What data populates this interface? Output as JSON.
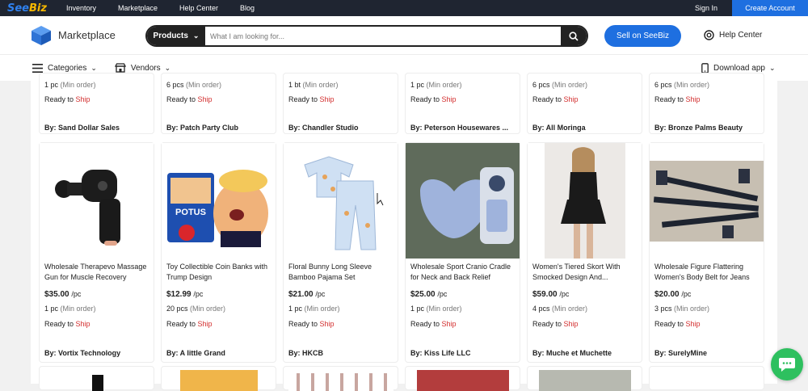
{
  "topbar": {
    "logo_see": "See",
    "logo_biz": "Biz",
    "nav": [
      "Inventory",
      "Marketplace",
      "Help Center",
      "Blog"
    ],
    "signin": "Sign In",
    "create_account": "Create Account"
  },
  "header": {
    "title": "Marketplace",
    "search_category": "Products",
    "search_placeholder": "What I am looking for...",
    "sell_button": "Sell on SeeBiz",
    "help_center": "Help Center"
  },
  "subnav": {
    "categories": "Categories",
    "vendors": "Vendors",
    "download_app": "Download app"
  },
  "top_row": [
    {
      "qty": "1 pc",
      "min": "(Min order)",
      "ready": "Ready to",
      "ship": "Ship",
      "vendor": "By: Sand Dollar Sales"
    },
    {
      "qty": "6 pcs",
      "min": "(Min order)",
      "ready": "Ready to",
      "ship": "Ship",
      "vendor": "By: Patch Party Club"
    },
    {
      "qty": "1 bt",
      "min": "(Min order)",
      "ready": "Ready to",
      "ship": "Ship",
      "vendor": "By: Chandler Studio"
    },
    {
      "qty": "1 pc",
      "min": "(Min order)",
      "ready": "Ready to",
      "ship": "Ship",
      "vendor": "By: Peterson Housewares ..."
    },
    {
      "qty": "6 pcs",
      "min": "(Min order)",
      "ready": "Ready to",
      "ship": "Ship",
      "vendor": "By: All Moringa"
    },
    {
      "qty": "6 pcs",
      "min": "(Min order)",
      "ready": "Ready to",
      "ship": "Ship",
      "vendor": "By: Bronze Palms Beauty"
    }
  ],
  "products": [
    {
      "title": "Wholesale Therapevo Massage Gun for Muscle Recovery",
      "price": "$35.00",
      "per": "/pc",
      "qty": "1 pc",
      "min": "(Min order)",
      "ready": "Ready to",
      "ship": "Ship",
      "vendor": "By: Vortix Technology",
      "image": "massage-gun-image"
    },
    {
      "title": "Toy Collectible Coin Banks with Trump Design",
      "price": "$12.99",
      "per": "/pc",
      "qty": "20 pcs",
      "min": "(Min order)",
      "ready": "Ready to",
      "ship": "Ship",
      "vendor": "By: A little Grand",
      "image": "coin-bank-image",
      "image_text": "POTUS"
    },
    {
      "title": "Floral Bunny Long Sleeve Bamboo Pajama Set",
      "price": "$21.00",
      "per": "/pc",
      "qty": "1 pc",
      "min": "(Min order)",
      "ready": "Ready to",
      "ship": "Ship",
      "vendor": "By: HKCB",
      "image": "pajama-set-image"
    },
    {
      "title": "Wholesale Sport Cranio Cradle for Neck and Back Relief",
      "price": "$25.00",
      "per": "/pc",
      "qty": "1 pc",
      "min": "(Min order)",
      "ready": "Ready to",
      "ship": "Ship",
      "vendor": "By: Kiss Life LLC",
      "image": "cranio-cradle-image"
    },
    {
      "title": "Women's Tiered Skort With Smocked Design And...",
      "price": "$59.00",
      "per": "/pc",
      "qty": "4 pcs",
      "min": "(Min order)",
      "ready": "Ready to",
      "ship": "Ship",
      "vendor": "By: Muche et Muchette",
      "image": "skort-image"
    },
    {
      "title": "Wholesale Figure Flattering Women's Body Belt for Jeans",
      "price": "$20.00",
      "per": "/pc",
      "qty": "3 pcs",
      "min": "(Min order)",
      "ready": "Ready to",
      "ship": "Ship",
      "vendor": "By: SurelyMine",
      "image": "body-belt-image"
    }
  ],
  "colors": {
    "topbar_bg": "#1f2531",
    "accent_blue": "#1e6fe0",
    "ship_red": "#d32f2f",
    "chat_green": "#2ec05f"
  }
}
